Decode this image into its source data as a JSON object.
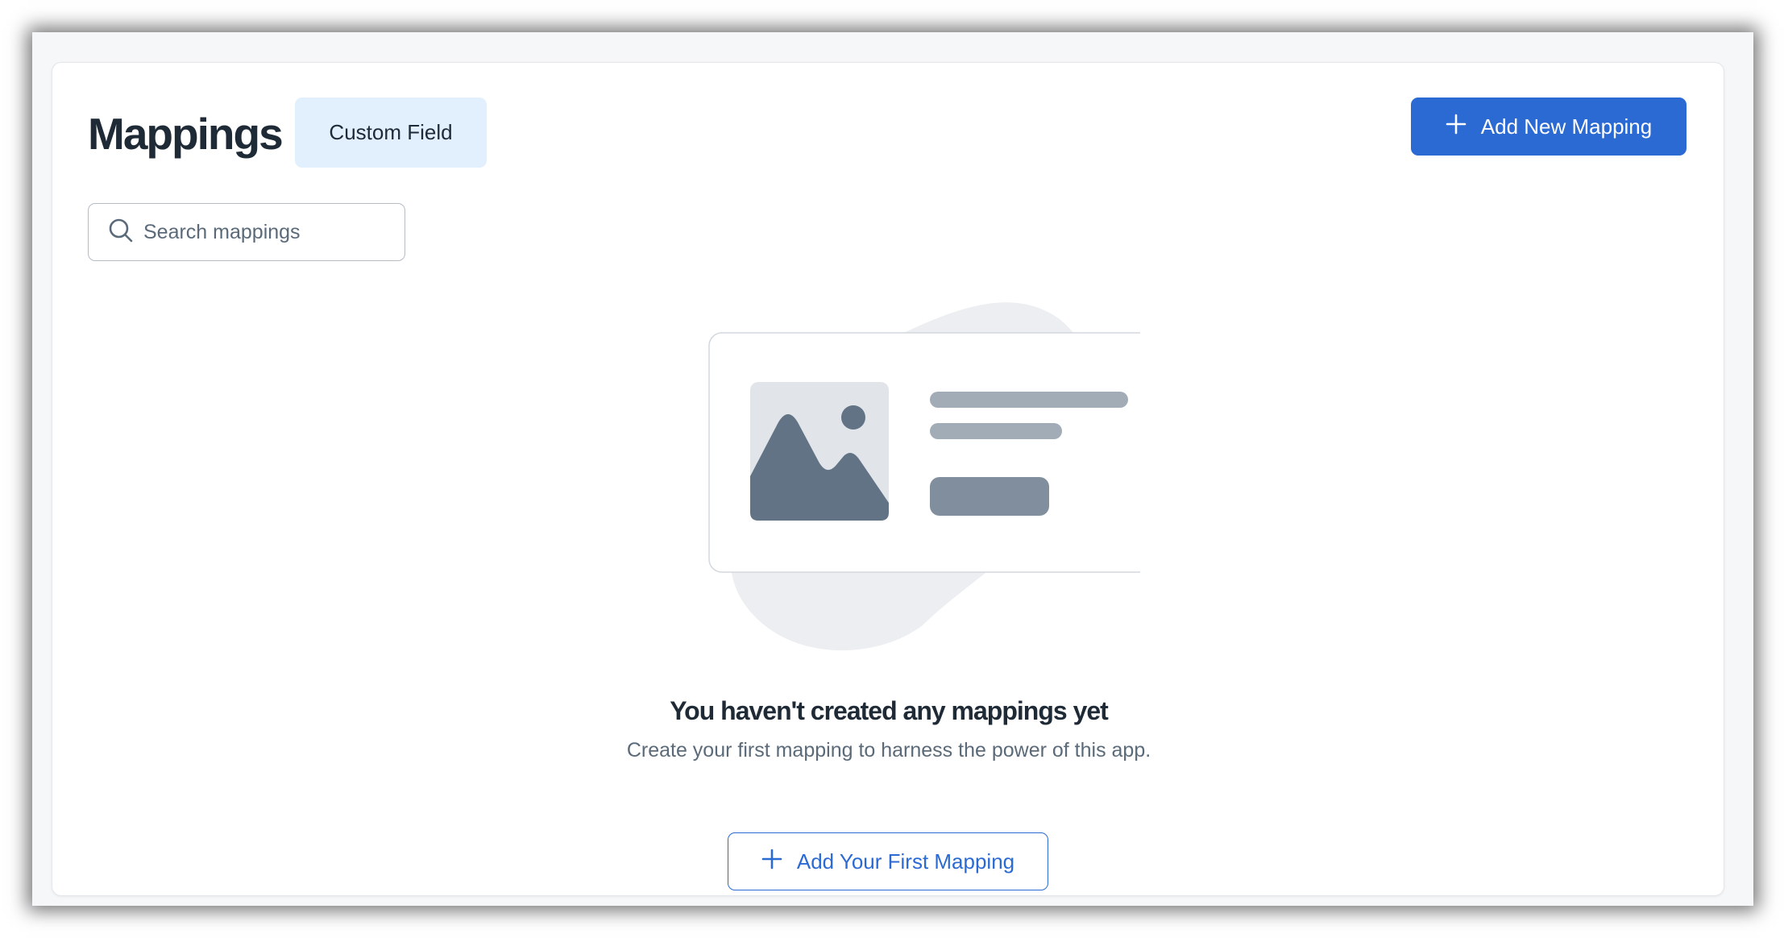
{
  "header": {
    "title": "Mappings",
    "tab_label": "Custom Field",
    "add_new_label": "Add New Mapping"
  },
  "search": {
    "placeholder": "Search mappings",
    "value": ""
  },
  "empty_state": {
    "title": "You haven't created any mappings yet",
    "subtitle": "Create your first mapping to harness the power of this app.",
    "button_label": "Add Your First Mapping"
  },
  "icons": {
    "add": "plus-icon",
    "search": "search-icon",
    "illustration": "image-placeholder-illustration"
  },
  "colors": {
    "accent": "#2b6ad3",
    "tab_bg": "#e2effc",
    "title_text": "#1f2a37",
    "muted_text": "#5b6a79"
  }
}
